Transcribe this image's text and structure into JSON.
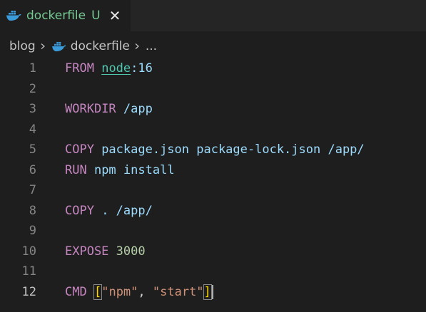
{
  "tab": {
    "icon": "docker-whale-icon",
    "label": "dockerfile",
    "status": "U",
    "close_glyph": "✕",
    "color": "#73c991"
  },
  "breadcrumb": {
    "root": "blog",
    "file": "dockerfile",
    "ellipsis": "..."
  },
  "editor": {
    "active_line": 12,
    "line_numbers": [
      "1",
      "2",
      "3",
      "4",
      "5",
      "6",
      "7",
      "8",
      "9",
      "10",
      "11",
      "12"
    ],
    "lines": [
      {
        "kw": "FROM",
        "sp": " ",
        "node": "node",
        "colon": ":",
        "ver": "16"
      },
      {},
      {
        "kw": "WORKDIR",
        "rest": " /app"
      },
      {},
      {
        "kw": "COPY",
        "rest": " package.json package-lock.json /app/"
      },
      {
        "kw": "RUN",
        "rest": " npm install"
      },
      {},
      {
        "kw": "COPY",
        "rest": " . /app/"
      },
      {},
      {
        "kw": "EXPOSE",
        "sp": " ",
        "num": "3000"
      },
      {},
      {
        "kw": "CMD",
        "sp": " ",
        "open": "[",
        "s1": "\"npm\"",
        "comma": ", ",
        "s2": "\"start\"",
        "close": "]"
      }
    ]
  },
  "colors": {
    "background": "#1e1e1e",
    "keyword": "#c586c0",
    "identifier": "#9cdcfe",
    "number": "#b5cea8",
    "string": "#ce9178",
    "type": "#4ec9b0",
    "bracket": "#ffd700"
  }
}
